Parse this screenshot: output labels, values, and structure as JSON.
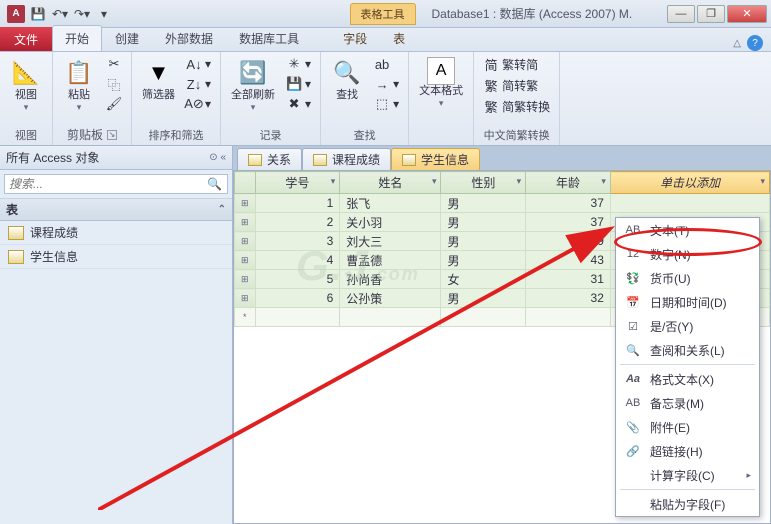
{
  "titlebar": {
    "doc_title": "Database1 : 数据库 (Access 2007) M.",
    "tool_tab": "表格工具"
  },
  "ribbon_tabs": {
    "file": "文件",
    "home": "开始",
    "create": "创建",
    "external": "外部数据",
    "dbtools": "数据库工具",
    "field": "字段",
    "table": "表"
  },
  "groups": {
    "view": {
      "label": "视图",
      "btn": "视图"
    },
    "clipboard": {
      "label": "剪贴板",
      "paste": "粘贴"
    },
    "sortfilter": {
      "label": "排序和筛选",
      "filter": "筛选器"
    },
    "records": {
      "label": "记录",
      "refresh": "全部刷新"
    },
    "find": {
      "label": "查找",
      "find": "查找"
    },
    "textformat": {
      "label": "",
      "btn": "文本格式"
    },
    "chinese": {
      "label": "中文简繁转换",
      "a": "繁转简",
      "b": "简转繁",
      "c": "简繁转换"
    }
  },
  "nav": {
    "header": "所有 Access 对象",
    "search_placeholder": "搜索...",
    "group": "表",
    "items": [
      "课程成绩",
      "学生信息"
    ]
  },
  "tabs": [
    "关系",
    "课程成绩",
    "学生信息"
  ],
  "columns": {
    "id": "学号",
    "name": "姓名",
    "gender": "性别",
    "age": "年龄",
    "add": "单击以添加"
  },
  "rows": [
    {
      "id": "1",
      "name": "张飞",
      "gender": "男",
      "age": "37"
    },
    {
      "id": "2",
      "name": "关小羽",
      "gender": "男",
      "age": "37"
    },
    {
      "id": "3",
      "name": "刘大三",
      "gender": "男",
      "age": "39"
    },
    {
      "id": "4",
      "name": "曹孟德",
      "gender": "男",
      "age": "43"
    },
    {
      "id": "5",
      "name": "孙尚香",
      "gender": "女",
      "age": "31"
    },
    {
      "id": "6",
      "name": "公孙策",
      "gender": "男",
      "age": "32"
    }
  ],
  "menu": {
    "text": "文本(T)",
    "number": "数字(N)",
    "currency": "货币(U)",
    "datetime": "日期和时间(D)",
    "yesno": "是/否(Y)",
    "lookup": "查阅和关系(L)",
    "richtext": "格式文本(X)",
    "memo": "备忘录(M)",
    "attachment": "附件(E)",
    "hyperlink": "超链接(H)",
    "calculated": "计算字段(C)",
    "pasteas": "粘贴为字段(F)"
  }
}
